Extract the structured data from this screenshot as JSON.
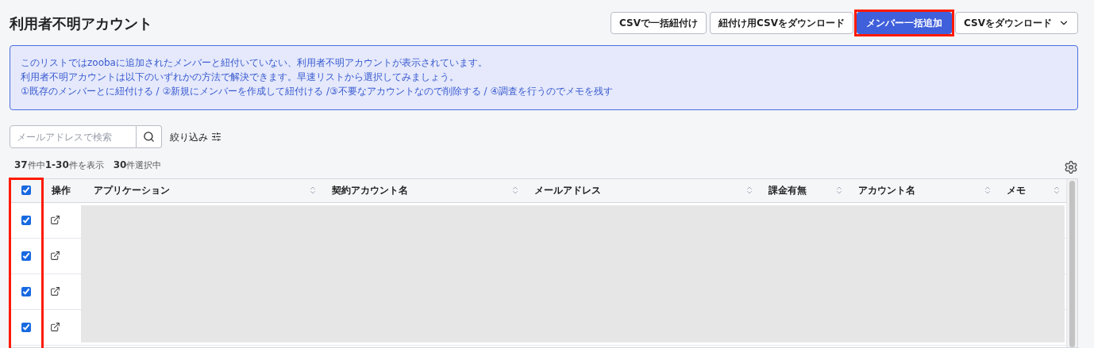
{
  "title": "利用者不明アカウント",
  "actions": [
    {
      "label": "CSVで一括紐付け",
      "kind": "outline",
      "highlighted": false,
      "dropdown": false
    },
    {
      "label": "紐付け用CSVをダウンロード",
      "kind": "outline",
      "highlighted": false,
      "dropdown": false
    },
    {
      "label": "メンバー一括追加",
      "kind": "primary",
      "highlighted": true,
      "dropdown": false
    },
    {
      "label": "CSVをダウンロード",
      "kind": "outline",
      "highlighted": false,
      "dropdown": true
    }
  ],
  "notice": [
    "このリストではzoobaに追加されたメンバーと紐付いていない、利用者不明アカウントが表示されています。",
    "利用者不明アカウントは以下のいずれかの方法で解決できます。早速リストから選択してみましょう。",
    "①既存のメンバーとに紐付ける / ②新規にメンバーを作成して紐付ける /③不要なアカウントなので削除する / ④調査を行うのでメモを残す"
  ],
  "search": {
    "placeholder": "メールアドレスで検索"
  },
  "filter": {
    "label": "絞り込み"
  },
  "summary": "**37**件中**1-30**件を表示",
  "selection": "**30**件選択中",
  "table": {
    "select_all_checked": true,
    "checkbox_column_highlighted": true,
    "columns": [
      {
        "label": "操作",
        "sortable": false
      },
      {
        "label": "アプリケーション",
        "sortable": true
      },
      {
        "label": "契約アカウント名",
        "sortable": true
      },
      {
        "label": "メールアドレス",
        "sortable": true
      },
      {
        "label": "課金有無",
        "sortable": true
      },
      {
        "label": "アカウント名",
        "sortable": true
      },
      {
        "label": "メモ",
        "sortable": true
      }
    ],
    "rows": [
      {
        "checked": true
      },
      {
        "checked": true
      },
      {
        "checked": true
      },
      {
        "checked": true
      }
    ]
  }
}
